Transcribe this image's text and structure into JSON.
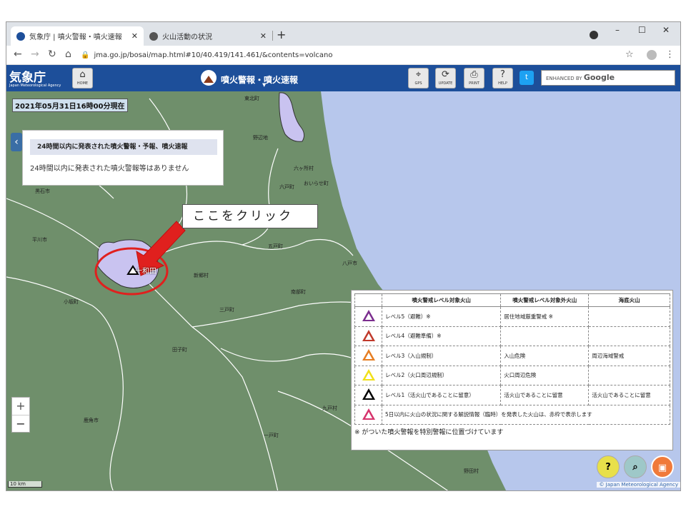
{
  "browser": {
    "tabs": [
      {
        "title": "気象庁 | 噴火警報・噴火速報",
        "active": true
      },
      {
        "title": "火山活動の状況",
        "active": false
      }
    ],
    "new_tab": "+",
    "url": "jma.go.jp/bosai/map.html#10/40.419/141.461/&contents=volcano",
    "window_controls": [
      "–",
      "☐",
      "✕"
    ]
  },
  "header": {
    "logo_jp": "気象庁",
    "logo_en": "Japan Meteorological Agency",
    "home_label": "HOME",
    "title": "噴火警報・噴火速報",
    "buttons": [
      "GPS",
      "UPDATE",
      "PRINT",
      "HELP"
    ],
    "search_placeholder": "ENHANCED BY",
    "search_brand": "Google"
  },
  "map": {
    "datestamp": "2021年05月31日16時00分現在",
    "info_header": "24時間以内に発表された噴火警報・予報、噴火速報",
    "info_body": "24時間以内に発表された噴火警報等はありません",
    "callout": "ここをクリック",
    "volcano_name": "十和田",
    "places": [
      "東北町",
      "野辺地",
      "六ヶ所村",
      "黒石市",
      "六戸町",
      "おいらせ町",
      "平川市",
      "五戸町",
      "八戸市",
      "新郷村",
      "南部町",
      "小坂町",
      "三戸町",
      "田子町",
      "鹿角市",
      "九戸村",
      "一戸町",
      "野田村"
    ],
    "zoom_in": "+",
    "zoom_out": "−",
    "scale": "10 km",
    "copyright": "© Japan Meteorological Agency"
  },
  "legend": {
    "headers": [
      "噴火警戒レベル対象火山",
      "噴火警戒レベル対象外火山",
      "海底火山"
    ],
    "rows": [
      {
        "color": "#7b2d8e",
        "col1": "レベル5（避難）※",
        "col2": "居住地域厳重警戒 ※",
        "col3": ""
      },
      {
        "color": "#c0392b",
        "col1": "レベル4（避難準備）※",
        "col2": "",
        "col3": ""
      },
      {
        "color": "#e67e22",
        "col1": "レベル3（入山規制）",
        "col2": "入山危険",
        "col3": "周辺海域警戒"
      },
      {
        "color": "#f1e019",
        "col1": "レベル2（火口周辺規制）",
        "col2": "火口周辺危険",
        "col3": ""
      },
      {
        "color": "#000000",
        "col1": "レベル1（活火山であることに留意）",
        "col2": "活火山であることに留意",
        "col3": "活火山であることに留意"
      }
    ],
    "last_row": {
      "color": "#d6336c",
      "text": "5日以内に火山の状況に関する解説情報（臨時）を発表した火山は、赤枠で表示します"
    },
    "note": "※ がついた噴火警報を特別警報に位置づけています"
  }
}
